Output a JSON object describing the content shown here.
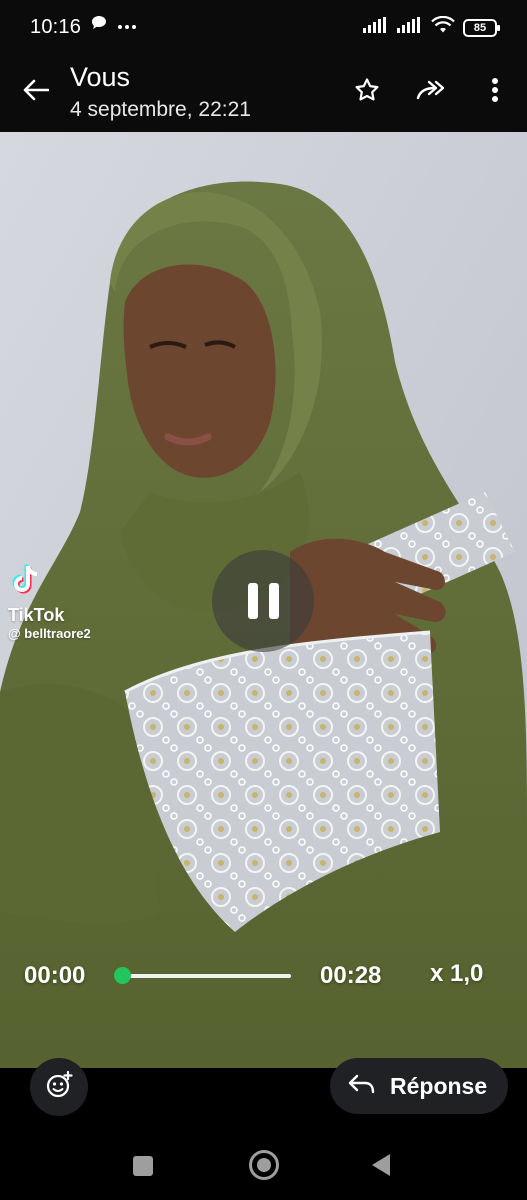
{
  "status_bar": {
    "time": "10:16",
    "battery": "85",
    "icons": [
      "chat-bubble-icon",
      "more-dots-icon",
      "signal-icon",
      "signal-icon",
      "wifi-icon",
      "battery-icon"
    ]
  },
  "header": {
    "title": "Vous",
    "subtitle": "4 septembre, 22:21",
    "icons": [
      "back-arrow-icon",
      "star-icon",
      "forward-icon",
      "more-vert-icon"
    ]
  },
  "video": {
    "watermark_app": "TikTok",
    "watermark_user": "@ belltraore2",
    "state_icon": "pause-icon"
  },
  "player": {
    "current_time": "00:00",
    "duration": "00:28",
    "speed": "x 1,0",
    "progress": 0
  },
  "footer": {
    "reply_label": "Réponse",
    "icons": [
      "emoji-add-icon",
      "reply-icon"
    ]
  },
  "nav": {
    "icons": [
      "recents-icon",
      "home-icon",
      "back-icon"
    ]
  },
  "colors": {
    "accent": "#22c55e",
    "bar_bg": "#0b0b0b",
    "pill_bg": "#1f2124",
    "hijab": "#5e6b3a"
  }
}
